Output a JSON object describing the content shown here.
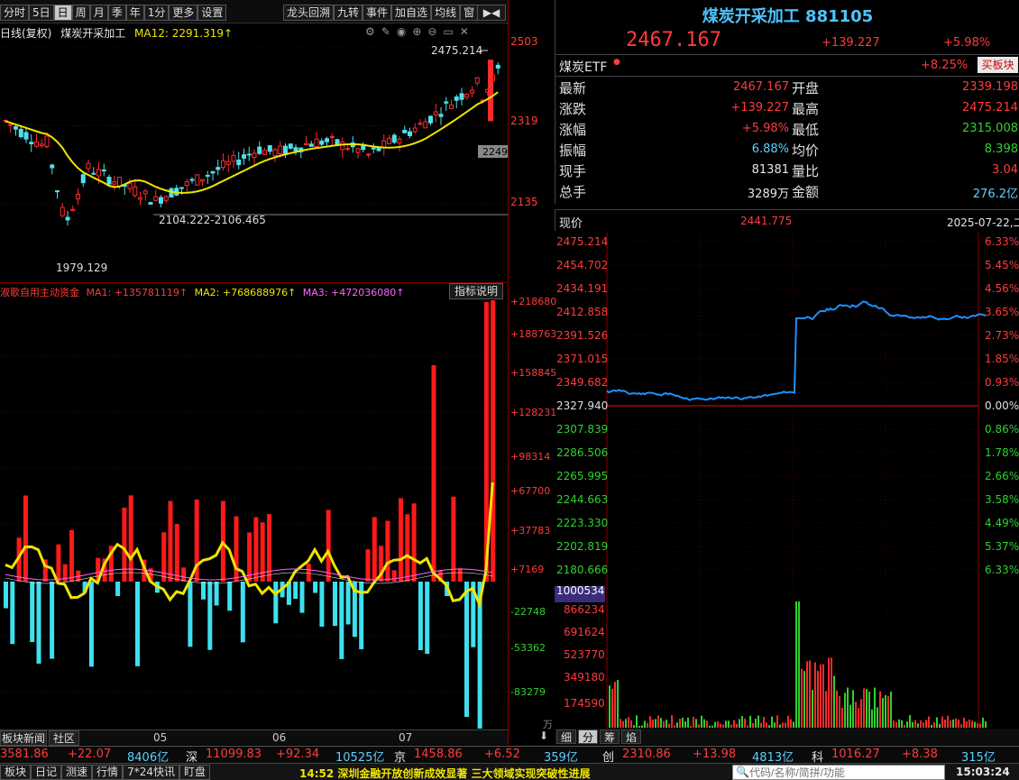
{
  "toolbar": {
    "items": [
      "分时",
      "5日",
      "日",
      "周",
      "月",
      "季",
      "年",
      "1分",
      "更多",
      "设置"
    ],
    "active": "日",
    "items2": [
      "龙头回溯",
      "九转",
      "事件",
      "加自选",
      "均线",
      "窗"
    ]
  },
  "kline": {
    "period_label": "日线(复权)",
    "name": "煤炭开采加工",
    "ma_label": "MA12: 2291.319↑",
    "y_ticks": [
      "2503",
      "2319",
      "2135"
    ],
    "high_label": "2475.214",
    "low_label": "1979.129",
    "range_label": "2104.222-2106.465",
    "price_tag": "2249"
  },
  "indicator": {
    "title": "淑歌自用主动资金",
    "ma1": "MA1: +135781119↑",
    "ma2": "MA2: +768688976↑",
    "ma3": "MA3: +472036080↑",
    "help": "指标说明",
    "y_ticks": [
      "+218680",
      "+188763",
      "+158845",
      "+128231",
      "+98314",
      "+67700",
      "+37783",
      "+7169",
      "-22748",
      "-53362",
      "-83279"
    ],
    "y_unit": "万"
  },
  "bottom_tabs": {
    "news": "板块新闻",
    "community": "社区"
  },
  "months": [
    "05",
    "06",
    "07"
  ],
  "quote": {
    "title": "煤炭开采加工 881105",
    "price": "2467.167",
    "change": "+139.227",
    "pct": "+5.98%",
    "etf_name": "煤炭ETF",
    "etf_pct": "+8.25%",
    "buy_btn": "买板块",
    "rows": [
      [
        "最新",
        "2467.167",
        "开盘",
        "2339.198"
      ],
      [
        "涨跌",
        "+139.227",
        "最高",
        "2475.214"
      ],
      [
        "涨幅",
        "+5.98%",
        "最低",
        "2315.008"
      ],
      [
        "振幅",
        "6.88%",
        "均价",
        "8.398"
      ],
      [
        "现手",
        "81381",
        "量比",
        "3.04"
      ],
      [
        "总手",
        "3289万",
        "金额",
        "276.2亿"
      ]
    ]
  },
  "intraday": {
    "label": "现价",
    "value": "2441.775",
    "date": "2025-07-22,二",
    "left_ticks": [
      "2475.214",
      "2454.702",
      "2434.191",
      "2412.858",
      "2391.526",
      "2371.015",
      "2349.682",
      "2327.940",
      "2307.839",
      "2286.506",
      "2265.995",
      "2244.663",
      "2223.330",
      "2202.819",
      "2180.666"
    ],
    "right_ticks": [
      "6.33%",
      "5.45%",
      "4.56%",
      "3.65%",
      "2.73%",
      "1.85%",
      "0.93%",
      "0.00%",
      "0.86%",
      "1.78%",
      "2.66%",
      "3.58%",
      "4.49%",
      "5.37%",
      "6.33%"
    ],
    "vol_ticks": [
      "1000534",
      "866234",
      "691624",
      "523770",
      "349180",
      "174590"
    ],
    "tabs": [
      "细",
      "分",
      "筹",
      "焰"
    ]
  },
  "index_bar": [
    {
      "name": "",
      "value": "3581.86",
      "chg": "+22.07",
      "amt": "8406亿"
    },
    {
      "name": "深",
      "value": "11099.83",
      "chg": "+92.34",
      "amt": "10525亿"
    },
    {
      "name": "京",
      "value": "1458.86",
      "chg": "+6.52",
      "amt": "359亿"
    },
    {
      "name": "创",
      "value": "2310.86",
      "chg": "+13.98",
      "amt": "4813亿"
    },
    {
      "name": "科",
      "value": "1016.27",
      "chg": "+8.38",
      "amt": "315亿"
    }
  ],
  "status_bar": {
    "buttons": [
      "板块",
      "日记",
      "测速",
      "行情",
      "7*24快讯",
      "盯盘"
    ],
    "news": "14:52 深圳金融开放创新成效显著 三大领域实现突破性进展",
    "search_placeholder": "代码/名称/简拼/功能",
    "time": "15:03:24"
  },
  "colors": {
    "up": "#ff3b3b",
    "down": "#2fd12f",
    "ma": "#f0e400",
    "line": "#1e90ff",
    "cyan": "#4fe0ee",
    "grid": "#8b0000"
  },
  "chart_data": [
    {
      "type": "line",
      "title": "日线(复权) 煤炭开采加工",
      "series": [
        {
          "name": "MA12",
          "values_note": "",
          "last": 2291.319
        }
      ],
      "ylim": [
        2135,
        2503
      ],
      "high": 2475.214,
      "low": 1979.129
    },
    {
      "type": "bar",
      "title": "淑歌自用主动资金",
      "ylim": [
        -83279,
        218680
      ]
    },
    {
      "type": "line",
      "title": "现价",
      "ylim": [
        2180.666,
        2475.214
      ],
      "prev_close": 2327.94
    }
  ]
}
